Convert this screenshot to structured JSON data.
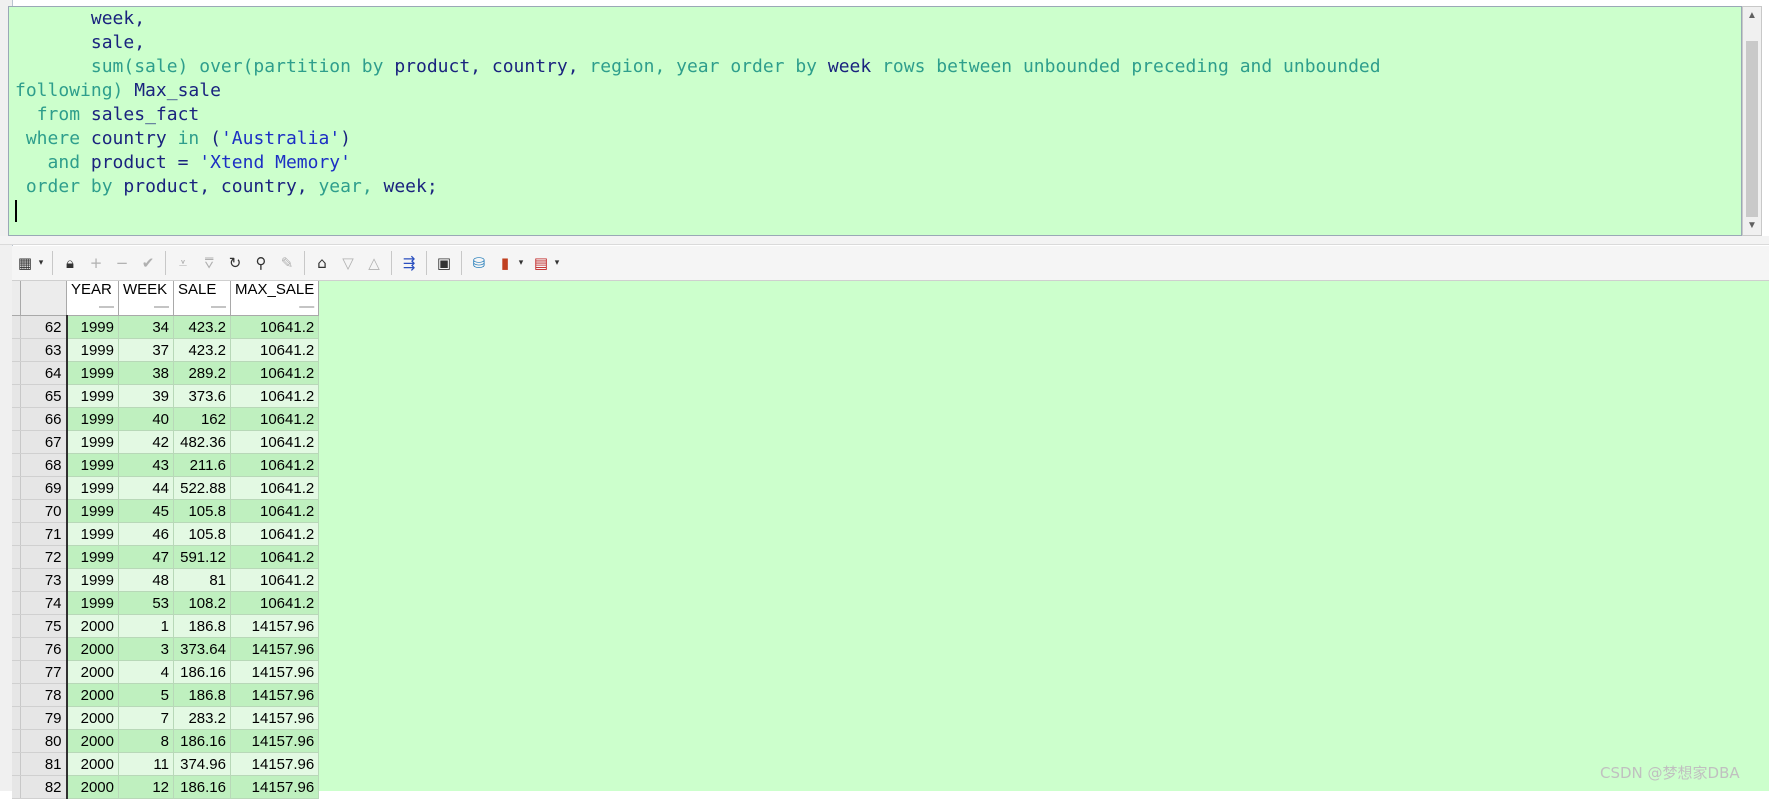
{
  "editor": {
    "line_week": "week,",
    "line_sale": "sale,",
    "sum_fn": "sum(sale)",
    "over_kw": "over(partition by",
    "col_product": "product,",
    "col_country": "country,",
    "col_region_kw": "region,",
    "col_year_kw": "year",
    "order_by_kw": "order by",
    "col_week": "week",
    "rows_between_kw": "rows between unbounded preceding and unbounded",
    "following_kw": "following)",
    "alias": "Max_sale",
    "from_kw": "from",
    "table": "sales_fact",
    "where_kw": "where",
    "where_col": "country",
    "in_kw": "in",
    "paren_open": "(",
    "where_val": "'Australia'",
    "paren_close": ")",
    "and_kw": "and",
    "and_col": "product =",
    "and_val": "'Xtend Memory'",
    "order_kw": "order by",
    "order_cols_a": "product, country,",
    "order_year": "year,",
    "order_week": "week;"
  },
  "toolbar": {
    "icons": [
      "grid-view-icon",
      "lock-icon",
      "add-record-icon",
      "delete-record-icon",
      "post-edit-icon",
      "fetch-next-icon",
      "fetch-all-icon",
      "refresh-icon",
      "find-icon",
      "clear-icon",
      "query-by-example-icon",
      "sort-desc-icon",
      "sort-asc-icon",
      "link-icon",
      "save-icon",
      "export-icon",
      "chart-icon",
      "report-icon"
    ]
  },
  "grid": {
    "columns": [
      "YEAR",
      "WEEK",
      "SALE",
      "MAX_SALE"
    ],
    "rows": [
      {
        "n": "62",
        "year": "1999",
        "week": "34",
        "sale": "423.2",
        "max": "10641.2"
      },
      {
        "n": "63",
        "year": "1999",
        "week": "37",
        "sale": "423.2",
        "max": "10641.2"
      },
      {
        "n": "64",
        "year": "1999",
        "week": "38",
        "sale": "289.2",
        "max": "10641.2"
      },
      {
        "n": "65",
        "year": "1999",
        "week": "39",
        "sale": "373.6",
        "max": "10641.2"
      },
      {
        "n": "66",
        "year": "1999",
        "week": "40",
        "sale": "162",
        "max": "10641.2"
      },
      {
        "n": "67",
        "year": "1999",
        "week": "42",
        "sale": "482.36",
        "max": "10641.2"
      },
      {
        "n": "68",
        "year": "1999",
        "week": "43",
        "sale": "211.6",
        "max": "10641.2"
      },
      {
        "n": "69",
        "year": "1999",
        "week": "44",
        "sale": "522.88",
        "max": "10641.2"
      },
      {
        "n": "70",
        "year": "1999",
        "week": "45",
        "sale": "105.8",
        "max": "10641.2"
      },
      {
        "n": "71",
        "year": "1999",
        "week": "46",
        "sale": "105.8",
        "max": "10641.2"
      },
      {
        "n": "72",
        "year": "1999",
        "week": "47",
        "sale": "591.12",
        "max": "10641.2"
      },
      {
        "n": "73",
        "year": "1999",
        "week": "48",
        "sale": "81",
        "max": "10641.2"
      },
      {
        "n": "74",
        "year": "1999",
        "week": "53",
        "sale": "108.2",
        "max": "10641.2"
      },
      {
        "n": "75",
        "year": "2000",
        "week": "1",
        "sale": "186.8",
        "max": "14157.96"
      },
      {
        "n": "76",
        "year": "2000",
        "week": "3",
        "sale": "373.64",
        "max": "14157.96"
      },
      {
        "n": "77",
        "year": "2000",
        "week": "4",
        "sale": "186.16",
        "max": "14157.96"
      },
      {
        "n": "78",
        "year": "2000",
        "week": "5",
        "sale": "186.8",
        "max": "14157.96"
      },
      {
        "n": "79",
        "year": "2000",
        "week": "7",
        "sale": "283.2",
        "max": "14157.96"
      },
      {
        "n": "80",
        "year": "2000",
        "week": "8",
        "sale": "186.16",
        "max": "14157.96"
      },
      {
        "n": "81",
        "year": "2000",
        "week": "11",
        "sale": "374.96",
        "max": "14157.96"
      },
      {
        "n": "82",
        "year": "2000",
        "week": "12",
        "sale": "186.16",
        "max": "14157.96"
      }
    ]
  },
  "watermark": "CSDN @梦想家DBA"
}
